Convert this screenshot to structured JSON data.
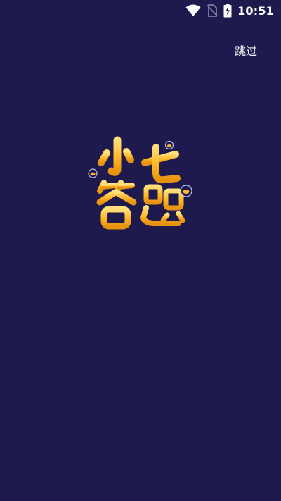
{
  "status_bar": {
    "time": "10:51",
    "icons": [
      "wifi-icon",
      "no-sim-icon",
      "battery-charging-icon"
    ]
  },
  "skip_button": {
    "label": "跳过"
  },
  "logo": {
    "text": "小七答题",
    "colors": {
      "fill": "#ffb627",
      "highlight": "#ffe07a",
      "shadow": "#d9830f"
    }
  },
  "colors": {
    "background": "#1e1a4e"
  }
}
